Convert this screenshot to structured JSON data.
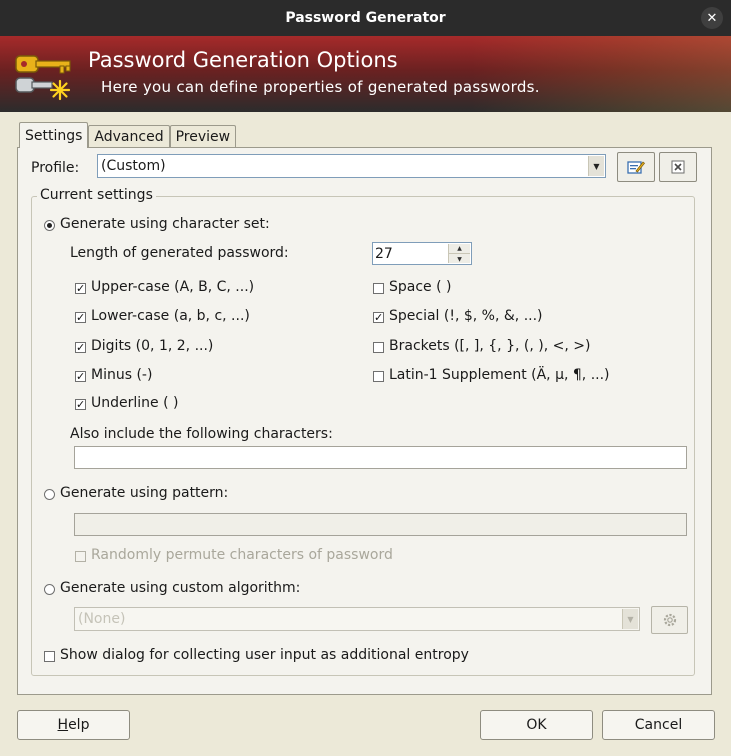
{
  "window": {
    "title": "Password Generator",
    "close_glyph": "✕"
  },
  "banner": {
    "title": "Password Generation Options",
    "subtitle": "Here you can define properties of generated passwords.",
    "icon": "keys-icon"
  },
  "tabs": [
    {
      "label": "Settings",
      "active": true
    },
    {
      "label": "Advanced",
      "active": false
    },
    {
      "label": "Preview",
      "active": false
    }
  ],
  "profile": {
    "label": "Profile:",
    "value": "(Custom)"
  },
  "group": {
    "label": "Current settings"
  },
  "charset": {
    "radio_label": "Generate using character set:",
    "length_label": "Length of generated password:",
    "length_value": "27",
    "options_left": [
      {
        "label": "Upper-case (A, B, C, ...)",
        "checked": true
      },
      {
        "label": "Lower-case (a, b, c, ...)",
        "checked": true
      },
      {
        "label": "Digits (0, 1, 2, ...)",
        "checked": true
      },
      {
        "label": "Minus (-)",
        "checked": true
      },
      {
        "label": "Underline ( )",
        "checked": true
      }
    ],
    "options_right": [
      {
        "label": "Space ( )",
        "checked": false
      },
      {
        "label": "Special (!, $, %, &, ...)",
        "checked": true
      },
      {
        "label": "Brackets ([, ], {, }, (, ), <, >)",
        "checked": false
      },
      {
        "label": "Latin-1 Supplement (Ä, µ, ¶, ...)",
        "checked": false
      }
    ],
    "also_include_label": "Also include the following characters:",
    "also_include_value": ""
  },
  "pattern": {
    "radio_label": "Generate using pattern:",
    "value": "",
    "permute_label": "Randomly permute characters of password"
  },
  "custom": {
    "radio_label": "Generate using custom algorithm:",
    "value": "(None)"
  },
  "entropy": {
    "label": "Show dialog for collecting user input as additional entropy"
  },
  "buttons": {
    "help": "Help",
    "ok": "OK",
    "cancel": "Cancel"
  },
  "check_glyph": "✓"
}
